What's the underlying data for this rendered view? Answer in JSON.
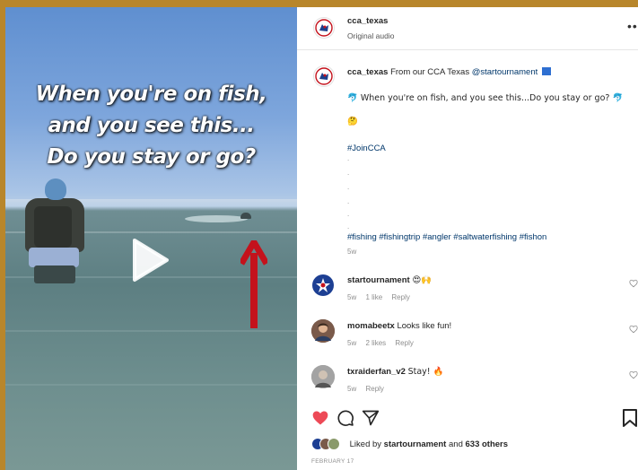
{
  "video": {
    "overlay_lines": [
      "When you're on fish,",
      "and you see this...",
      "Do you stay or go?"
    ]
  },
  "header": {
    "username": "cca_texas",
    "subtitle": "Original audio",
    "more_icon": "more-icon"
  },
  "caption": {
    "username": "cca_texas",
    "text": "From our CCA Texas",
    "mention": "@startournament",
    "line2": "🐬 When you're on fish, and you see this...Do you stay or go? 🐬",
    "line3": "🤔",
    "hashtag_join": "#JoinCCA",
    "dots": [
      ".",
      ".",
      ".",
      ".",
      ".",
      "."
    ],
    "hashtags": "#fishing #fishingtrip #angler #saltwaterfishing #fishon",
    "age": "5w"
  },
  "comments": [
    {
      "username": "startournament",
      "text": "😍🙌",
      "age": "5w",
      "likes": "1 like",
      "reply": "Reply"
    },
    {
      "username": "momabeetx",
      "text": "Looks like fun!",
      "age": "5w",
      "likes": "2 likes",
      "reply": "Reply"
    },
    {
      "username": "txraiderfan_v2",
      "text": "Stay! 🔥",
      "age": "5w",
      "likes": "",
      "reply": "Reply"
    }
  ],
  "likes": {
    "prefix": "Liked by",
    "user": "startournament",
    "middle": "and",
    "count": "633 others"
  },
  "date": "FEBRUARY 17",
  "colors": {
    "frame": "#b8862b",
    "link": "#00376b",
    "heart": "#ed4956",
    "arrow": "#c4121c"
  }
}
